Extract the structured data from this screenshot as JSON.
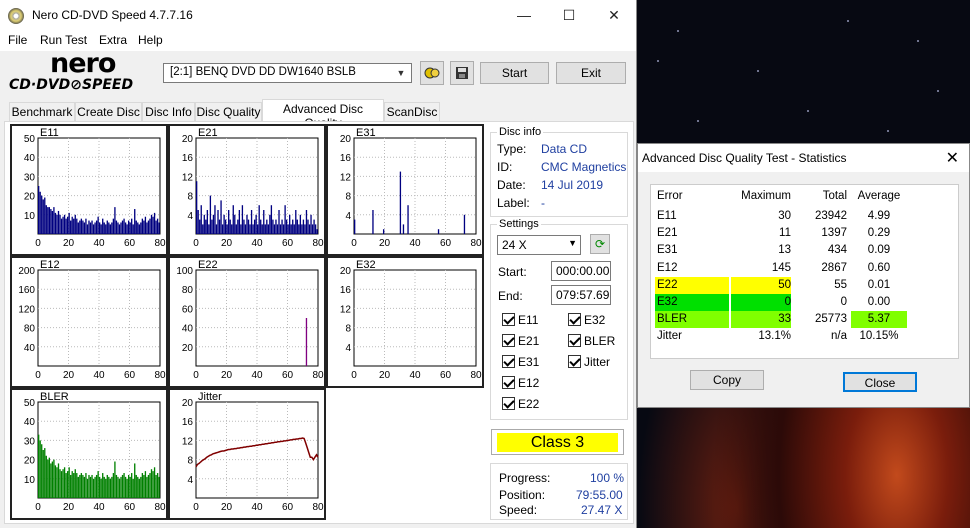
{
  "window": {
    "title": "Nero CD-DVD Speed 4.7.7.16",
    "minimize": "—",
    "maximize": "☐",
    "close": "✕"
  },
  "menu": [
    "File",
    "Run Test",
    "Extra",
    "Help"
  ],
  "logo": {
    "top": "nero",
    "bottom": "CD·DVD⊘SPEED"
  },
  "toolbar": {
    "drive": "[2:1]   BENQ DVD DD DW1640 BSLB",
    "start": "Start",
    "exit": "Exit",
    "icons": [
      "drive-icon",
      "save-icon"
    ]
  },
  "tabs": [
    "Benchmark",
    "Create Disc",
    "Disc Info",
    "Disc Quality",
    "Advanced Disc Quality",
    "ScanDisc"
  ],
  "active_tab": "Advanced Disc Quality",
  "disc_info": {
    "title": "Disc info",
    "type_label": "Type:",
    "type": "Data CD",
    "id_label": "ID:",
    "id": "CMC Magnetics",
    "date_label": "Date:",
    "date": "14 Jul 2019",
    "label_label": "Label:",
    "label": "-"
  },
  "settings": {
    "title": "Settings",
    "speed": "24 X",
    "start_label": "Start:",
    "start": "000:00.00",
    "end_label": "End:",
    "end": "079:57.69"
  },
  "checks": {
    "e11": "E11",
    "e32": "E32",
    "e21": "E21",
    "bler": "BLER",
    "e31": "E31",
    "jitter": "Jitter",
    "e12": "E12",
    "e22": "E22"
  },
  "class_label": "Class 3",
  "progress": {
    "progress_label": "Progress:",
    "progress": "100 %",
    "position_label": "Position:",
    "position": "79:55.00",
    "speed_label": "Speed:",
    "speed": "27.47 X"
  },
  "chart_data": [
    {
      "type": "bar",
      "title": "E11",
      "color": "#000080",
      "ylim": [
        0,
        50
      ],
      "yticks": [
        "50",
        "40",
        "30",
        "20",
        "10"
      ],
      "xticks": [
        "0",
        "20",
        "40",
        "60",
        "80"
      ],
      "xlim": [
        0,
        80
      ],
      "values": [
        25,
        22,
        20,
        18,
        19,
        15,
        14,
        14,
        13,
        12,
        14,
        11,
        10,
        12,
        10,
        8,
        9,
        10,
        8,
        9,
        11,
        7,
        9,
        8,
        10,
        8,
        6,
        7,
        8,
        7,
        6,
        8,
        5,
        7,
        6,
        7,
        5,
        6,
        7,
        9,
        6,
        5,
        8,
        6,
        5,
        7,
        6,
        5,
        6,
        8,
        14,
        7,
        6,
        5,
        6,
        7,
        8,
        6,
        5,
        7,
        6,
        8,
        5,
        13,
        7,
        6,
        5,
        6,
        8,
        7,
        9,
        6,
        7,
        8,
        10,
        9,
        11,
        7,
        8,
        6
      ]
    },
    {
      "type": "bar",
      "title": "E21",
      "color": "#000080",
      "ylim": [
        0,
        20
      ],
      "yticks": [
        "20",
        "16",
        "12",
        "8",
        "4"
      ],
      "xticks": [
        "0",
        "20",
        "40",
        "60",
        "80"
      ],
      "xlim": [
        0,
        80
      ],
      "values": [
        11,
        5,
        3,
        6,
        2,
        4,
        3,
        5,
        2,
        8,
        3,
        4,
        6,
        2,
        5,
        3,
        7,
        2,
        4,
        3,
        2,
        5,
        3,
        2,
        6,
        4,
        2,
        3,
        5,
        2,
        6,
        3,
        2,
        4,
        3,
        2,
        5,
        2,
        3,
        4,
        2,
        6,
        3,
        2,
        5,
        2,
        3,
        2,
        4,
        6,
        3,
        2,
        3,
        2,
        5,
        2,
        3,
        2,
        6,
        3,
        2,
        4,
        2,
        3,
        2,
        5,
        3,
        2,
        4,
        2,
        3,
        2,
        5,
        3,
        2,
        4,
        2,
        3,
        2,
        1
      ]
    },
    {
      "type": "bar",
      "title": "E31",
      "color": "#000080",
      "ylim": [
        0,
        20
      ],
      "yticks": [
        "20",
        "16",
        "12",
        "8",
        "4"
      ],
      "xticks": [
        "0",
        "20",
        "40",
        "60",
        "80"
      ],
      "xlim": [
        0,
        80
      ],
      "values": [
        3,
        0,
        0,
        0,
        0,
        0,
        0,
        0,
        0,
        0,
        0,
        0,
        5,
        0,
        0,
        0,
        0,
        0,
        0,
        1,
        0,
        0,
        0,
        0,
        0,
        0,
        0,
        0,
        0,
        0,
        13,
        0,
        2,
        0,
        0,
        6,
        0,
        0,
        0,
        0,
        0,
        0,
        0,
        0,
        0,
        0,
        0,
        0,
        0,
        0,
        0,
        0,
        0,
        0,
        0,
        1,
        0,
        0,
        0,
        0,
        0,
        0,
        0,
        0,
        0,
        0,
        0,
        0,
        0,
        0,
        0,
        0,
        4,
        0,
        0,
        0,
        0,
        0,
        0,
        0
      ]
    },
    {
      "type": "bar",
      "title": "E12",
      "color": "#800080",
      "ylim": [
        0,
        200
      ],
      "yticks": [
        "200",
        "160",
        "120",
        "80",
        "40"
      ],
      "xticks": [
        "0",
        "20",
        "40",
        "60",
        "80"
      ],
      "xlim": [
        0,
        80
      ],
      "values": [
        0,
        0,
        0,
        0,
        0,
        0,
        0,
        0,
        0,
        0,
        0,
        0,
        0,
        0,
        0,
        0,
        0,
        0,
        0,
        0,
        0,
        0,
        0,
        0,
        0,
        0,
        0,
        0,
        0,
        0,
        0,
        0,
        0,
        0,
        0,
        0,
        0,
        0,
        0,
        0,
        0,
        0,
        0,
        0,
        0,
        0,
        0,
        0,
        0,
        0,
        0,
        0,
        0,
        0,
        0,
        0,
        0,
        0,
        0,
        0,
        0,
        0,
        0,
        0,
        0,
        0,
        0,
        0,
        0,
        0,
        0,
        0,
        0,
        0,
        0,
        0,
        0,
        0,
        0,
        0
      ]
    },
    {
      "type": "bar",
      "title": "E22",
      "color": "#800080",
      "ylim": [
        0,
        100
      ],
      "yticks": [
        "100",
        "80",
        "60",
        "40",
        "20"
      ],
      "xticks": [
        "0",
        "20",
        "40",
        "60",
        "80"
      ],
      "xlim": [
        0,
        80
      ],
      "values": [
        0,
        0,
        0,
        0,
        0,
        0,
        0,
        0,
        0,
        0,
        0,
        0,
        0,
        0,
        0,
        0,
        0,
        0,
        0,
        0,
        0,
        0,
        0,
        0,
        0,
        0,
        0,
        0,
        0,
        0,
        0,
        0,
        0,
        0,
        0,
        0,
        0,
        0,
        0,
        0,
        0,
        0,
        0,
        0,
        0,
        0,
        0,
        0,
        0,
        0,
        0,
        0,
        0,
        0,
        0,
        0,
        0,
        0,
        0,
        0,
        0,
        0,
        0,
        0,
        0,
        0,
        0,
        0,
        0,
        0,
        0,
        0,
        50,
        0,
        0,
        0,
        0,
        0,
        0,
        0
      ]
    },
    {
      "type": "bar",
      "title": "E32",
      "color": "#800080",
      "ylim": [
        0,
        20
      ],
      "yticks": [
        "20",
        "16",
        "12",
        "8",
        "4"
      ],
      "xticks": [
        "0",
        "20",
        "40",
        "60",
        "80"
      ],
      "xlim": [
        0,
        80
      ],
      "values": []
    },
    {
      "type": "bar",
      "title": "BLER",
      "color": "#008000",
      "ylim": [
        0,
        50
      ],
      "yticks": [
        "50",
        "40",
        "30",
        "20",
        "10"
      ],
      "xticks": [
        "0",
        "20",
        "40",
        "60",
        "80"
      ],
      "xlim": [
        0,
        80
      ],
      "values": [
        33,
        30,
        28,
        25,
        26,
        22,
        20,
        21,
        18,
        19,
        20,
        17,
        16,
        18,
        15,
        14,
        15,
        16,
        13,
        14,
        16,
        12,
        14,
        13,
        15,
        13,
        11,
        12,
        13,
        12,
        11,
        13,
        10,
        12,
        11,
        12,
        10,
        11,
        12,
        14,
        11,
        10,
        13,
        11,
        10,
        12,
        11,
        10,
        11,
        13,
        19,
        12,
        11,
        10,
        11,
        12,
        13,
        11,
        10,
        12,
        11,
        13,
        10,
        18,
        12,
        11,
        10,
        11,
        13,
        12,
        14,
        11,
        12,
        13,
        15,
        14,
        16,
        12,
        13,
        11
      ]
    },
    {
      "type": "line",
      "title": "Jitter",
      "color": "#800000",
      "ylim": [
        0,
        20
      ],
      "yticks": [
        "20",
        "16",
        "12",
        "8",
        "4"
      ],
      "xticks": [
        "0",
        "20",
        "40",
        "60",
        "80"
      ],
      "xlim": [
        0,
        80
      ],
      "values": [
        6.5,
        7.0,
        7.2,
        7.5,
        7.8,
        8.0,
        8.2,
        8.5,
        8.7,
        8.9,
        9.0,
        9.2,
        9.3,
        9.4,
        9.5,
        9.6,
        9.7,
        9.8,
        9.8,
        9.9,
        10.0,
        10.1,
        10.1,
        10.2,
        10.2,
        10.3,
        10.3,
        10.4,
        10.4,
        10.5,
        10.5,
        10.6,
        10.6,
        10.7,
        10.7,
        10.8,
        10.8,
        10.9,
        10.9,
        11.0,
        11.0,
        11.1,
        11.1,
        11.2,
        11.2,
        11.3,
        11.3,
        11.4,
        11.4,
        11.5,
        11.5,
        11.6,
        11.6,
        11.7,
        11.7,
        11.8,
        11.8,
        11.9,
        11.9,
        12.0,
        12.0,
        12.1,
        12.1,
        12.2,
        12.2,
        12.3,
        12.3,
        12.4,
        12.4,
        12.5,
        12.4,
        11.5,
        10.5,
        9.5,
        8.5,
        8.5,
        8.0,
        8.5,
        9.0,
        8.5
      ]
    }
  ],
  "stats_dialog": {
    "title": "Advanced Disc Quality Test - Statistics",
    "headers": [
      "Error",
      "Maximum",
      "Total",
      "Average"
    ],
    "rows": [
      {
        "name": "E11",
        "max": "30",
        "total": "23942",
        "avg": "4.99",
        "hl": ""
      },
      {
        "name": "E21",
        "max": "11",
        "total": "1397",
        "avg": "0.29",
        "hl": ""
      },
      {
        "name": "E31",
        "max": "13",
        "total": "434",
        "avg": "0.09",
        "hl": ""
      },
      {
        "name": "E12",
        "max": "145",
        "total": "2867",
        "avg": "0.60",
        "hl": ""
      },
      {
        "name": "E22",
        "max": "50",
        "total": "55",
        "avg": "0.01",
        "hl": "#ffff00"
      },
      {
        "name": "E32",
        "max": "0",
        "total": "0",
        "avg": "0.00",
        "hl": "#00e000"
      },
      {
        "name": "BLER",
        "max": "33",
        "total": "25773",
        "avg": "5.37",
        "hl": "#80ff00"
      },
      {
        "name": "Jitter",
        "max": "13.1%",
        "total": "n/a",
        "avg": "10.15%",
        "hl": ""
      }
    ],
    "copy": "Copy",
    "close": "Close"
  }
}
